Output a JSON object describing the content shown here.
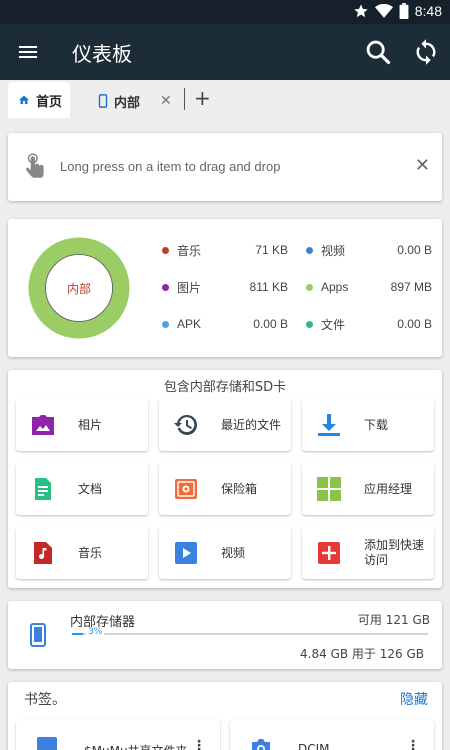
{
  "status_bar": {
    "time": "8:48"
  },
  "app_bar": {
    "title": "仪表板"
  },
  "tabs": [
    {
      "label": "首页"
    },
    {
      "label": "内部"
    }
  ],
  "hint": {
    "text": "Long press on a item to drag and drop"
  },
  "storage_chart": {
    "center_label": "内部",
    "legend": [
      {
        "label": "音乐",
        "value": "71 KB",
        "color": "#c0392b"
      },
      {
        "label": "视频",
        "value": "0.00 B",
        "color": "#3b82e0"
      },
      {
        "label": "图片",
        "value": "811 KB",
        "color": "#8e24aa"
      },
      {
        "label": "Apps",
        "value": "897 MB",
        "color": "#9ccc65"
      },
      {
        "label": "APK",
        "value": "0.00 B",
        "color": "#4ba3dd"
      },
      {
        "label": "文件",
        "value": "0.00 B",
        "color": "#26c281"
      }
    ],
    "ring_color": "#9ccc65"
  },
  "shortcuts": {
    "heading": "包含内部存储和SD卡",
    "items": [
      {
        "label": "相片",
        "icon": "photo-icon"
      },
      {
        "label": "最近的文件",
        "icon": "history-icon"
      },
      {
        "label": "下载",
        "icon": "download-icon"
      },
      {
        "label": "文档",
        "icon": "document-icon"
      },
      {
        "label": "保险箱",
        "icon": "safe-icon"
      },
      {
        "label": "应用经理",
        "icon": "apps-grid-icon"
      },
      {
        "label": "音乐",
        "icon": "music-icon"
      },
      {
        "label": "视频",
        "icon": "video-icon"
      },
      {
        "label": "添加到快速访问",
        "icon": "add-icon"
      }
    ]
  },
  "internal_storage": {
    "name": "内部存储器",
    "available": "可用 121 GB",
    "percent_label": "3%",
    "percent": 3,
    "used": "4.84 GB 用于 126 GB"
  },
  "bookmarks": {
    "heading": "书签。",
    "hide_label": "隐藏",
    "items": [
      {
        "label": "$MuMu共享文件夹"
      },
      {
        "label": "DCIM"
      }
    ]
  }
}
